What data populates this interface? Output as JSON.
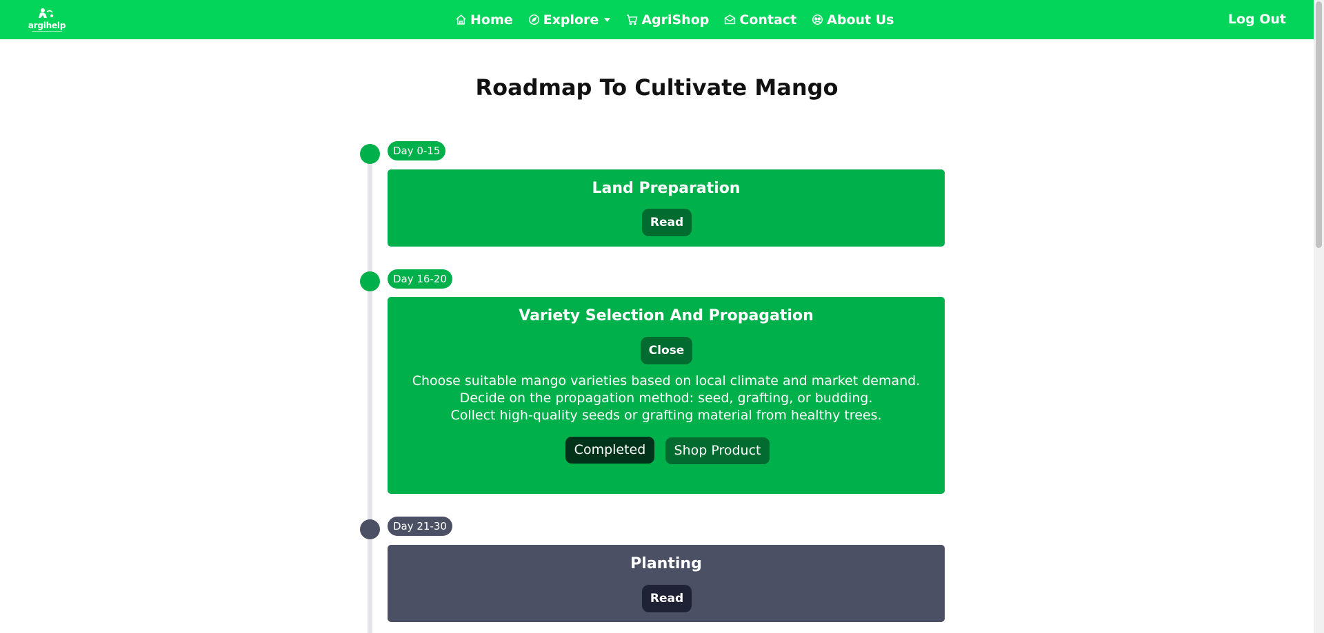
{
  "brand": {
    "name": "argihelp"
  },
  "nav": {
    "items": [
      {
        "label": "Home",
        "icon": "home-icon"
      },
      {
        "label": "Explore",
        "icon": "compass-icon"
      },
      {
        "label": "AgriShop",
        "icon": "cart-icon"
      },
      {
        "label": "Contact",
        "icon": "envelope-icon"
      },
      {
        "label": "About Us",
        "icon": "people-icon"
      }
    ],
    "logout": "Log Out"
  },
  "page": {
    "title": "Roadmap To Cultivate Mango"
  },
  "timeline": [
    {
      "days": "Day 0-15",
      "title": "Land Preparation",
      "button": "Read",
      "status_color": "#00b04a"
    },
    {
      "days": "Day 16-20",
      "title": "Variety Selection And Propagation",
      "button": "Close",
      "description": [
        "Choose suitable mango varieties based on local climate and market demand.",
        "Decide on the propagation method: seed, grafting, or budding.",
        "Collect high-quality seeds or grafting material from healthy trees."
      ],
      "completed_label": "Completed",
      "shop_label": "Shop Product",
      "status_color": "#00b04a"
    },
    {
      "days": "Day 21-30",
      "title": "Planting",
      "button": "Read",
      "status_color": "#4b5064"
    }
  ],
  "colors": {
    "nav_bg": "#03d45a",
    "done": "#00b04a",
    "done_button": "#016b30",
    "pending": "#4b5064",
    "pending_button": "#1f2235"
  }
}
